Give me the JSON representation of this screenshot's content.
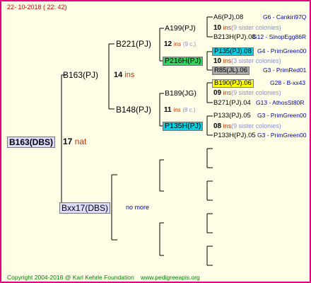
{
  "header": {
    "date": "22- 10-2018 ( 22: 42)"
  },
  "root": {
    "label": "B163(DBS)",
    "ins_count": "17",
    "ins_word": "nat"
  },
  "gen1": {
    "upper": {
      "label": "B163(PJ)",
      "ins_count": "14",
      "ins_word": "ins"
    },
    "lower": {
      "label": "Bxx17(DBS)",
      "note": "no more"
    }
  },
  "gen2": {
    "a": {
      "label": "B221(PJ)",
      "ins_count": "12",
      "ins_word": "ins",
      "sister": "(9 c.)"
    },
    "b": {
      "label": "B148(PJ)",
      "ins_count": "11",
      "ins_word": "ins",
      "sister": "(8 c.)"
    }
  },
  "gen3": {
    "a1": {
      "label": "A199(PJ)",
      "ins_count": "10",
      "ins_word": "ins",
      "sister": "(9 sister colonies)"
    },
    "a2": {
      "label": "P216H(PJ)",
      "ins_count": "10",
      "ins_word": "ins",
      "sister": "(3 sister colonies)"
    },
    "b1": {
      "label": "B189(JG)",
      "ins_count": "09",
      "ins_word": "ins",
      "sister": "(9 sister colonies)"
    },
    "b2": {
      "label": "P135H(PJ)",
      "ins_count": "08",
      "ins_word": "ins",
      "sister": "(9 sister colonies)"
    }
  },
  "gen4": [
    {
      "label": "A6(PJ).08",
      "info": "G6 - Cankiri97Q"
    },
    {
      "label": "B213H(PJ).08",
      "info": "G12 - SinopEgg86R"
    },
    {
      "label": "P135(PJ).08",
      "info": "G4 - PrimGreen00"
    },
    {
      "label": "R85(JL).06",
      "info": "G3 - PrimRed01"
    },
    {
      "label": "B190(PJ).06",
      "info": "G28 - B-xx43"
    },
    {
      "label": "B271(PJ).04",
      "info": "G13 - AthosSt80R"
    },
    {
      "label": "P133(PJ).05",
      "info": "G3 - PrimGreen00"
    },
    {
      "label": "P133H(PJ).05",
      "info": "G3 - PrimGreen00"
    }
  ],
  "footer": {
    "copyright": "Copyright 2004-2018 @ Karl Kehrle Foundation",
    "url": "www.pedigreeapis.org"
  },
  "colors": {
    "border": "#e6007e",
    "background": "#ffffe8",
    "ins_red": "#cc3300",
    "info_blue": "#0000b0",
    "highlight_cyan": "#00d2e6",
    "highlight_green": "#2ed65a",
    "highlight_gray": "#aaaaaa",
    "highlight_yellow": "#ffff00",
    "footer_green": "#008000"
  }
}
